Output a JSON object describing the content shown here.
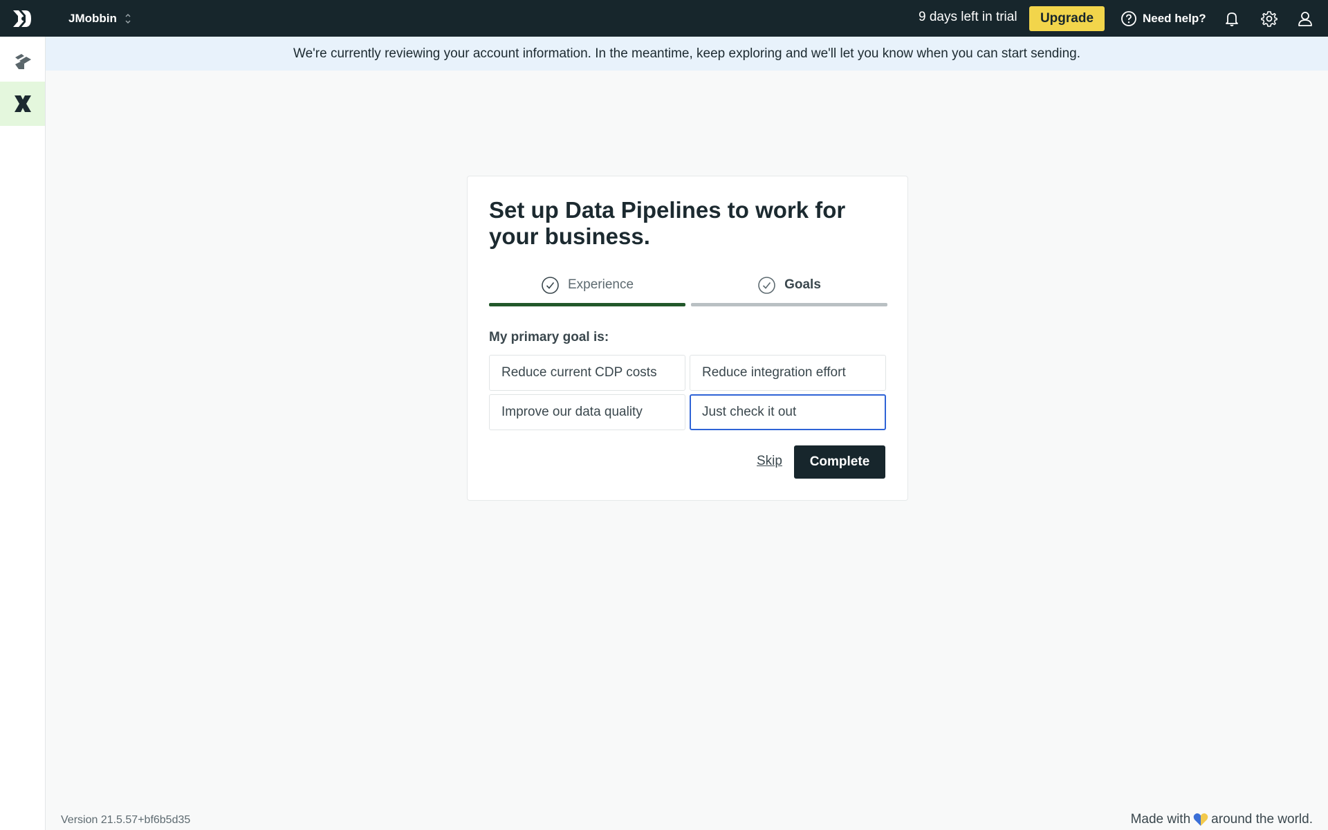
{
  "header": {
    "logo_icon": "customerio-logo-icon",
    "workspace_name": "JMobbin",
    "trial_text": "9 days left in trial",
    "upgrade_label": "Upgrade",
    "help_label": "Need help?",
    "icons": [
      "help-circle-icon",
      "bell-icon",
      "gear-icon",
      "user-icon"
    ]
  },
  "sidebar": {
    "items": [
      {
        "icon": "journeys-icon",
        "active": false
      },
      {
        "icon": "data-pipelines-icon",
        "active": true
      }
    ]
  },
  "banner": {
    "text": "We're currently reviewing your account information. In the meantime, keep exploring and we'll let you know when you can start sending."
  },
  "setup": {
    "title": "Set up Data Pipelines to work for your business.",
    "steps": [
      {
        "label": "Experience",
        "completed": true
      },
      {
        "label": "Goals",
        "active": true
      }
    ],
    "goal_label": "My primary goal is:",
    "options": [
      {
        "label": "Reduce current CDP costs",
        "selected": false
      },
      {
        "label": "Reduce integration effort",
        "selected": false
      },
      {
        "label": "Improve our data quality",
        "selected": false
      },
      {
        "label": "Just check it out",
        "selected": true
      }
    ],
    "skip_label": "Skip",
    "complete_label": "Complete"
  },
  "footer": {
    "version": "Version 21.5.57+bf6b5d35",
    "made_with_prefix": "Made with",
    "made_with_suffix": "around the world."
  },
  "colors": {
    "topbar": "#17262c",
    "upgrade": "#f2d54b",
    "banner": "#e8f2fb",
    "progress_active": "#23582b",
    "progress_inactive": "#b9c0c3",
    "selected_border": "#2e63d6",
    "sidebar_active": "#e4f7dd"
  }
}
